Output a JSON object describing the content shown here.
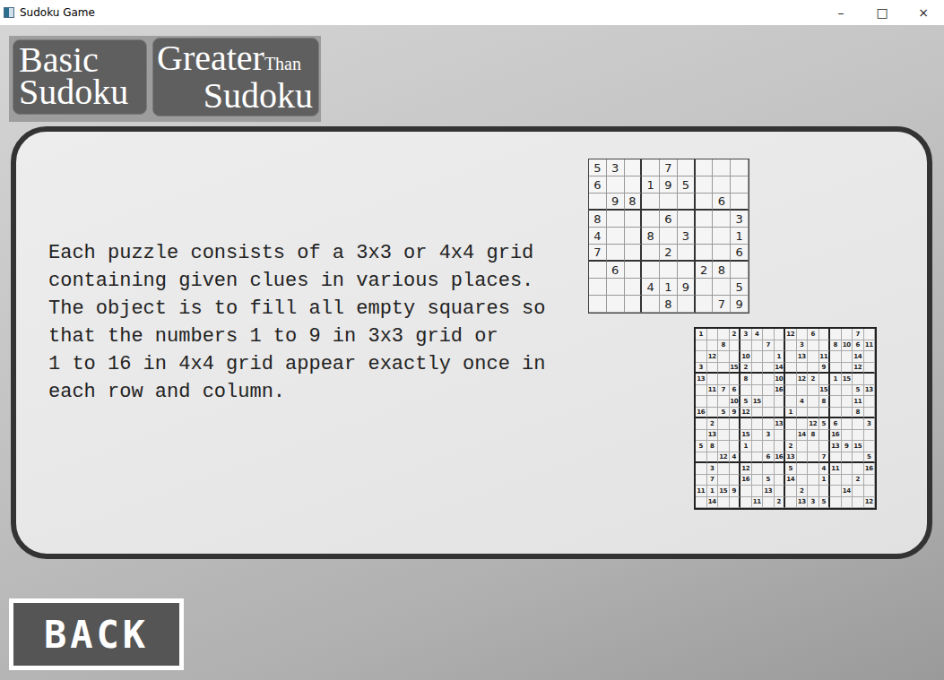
{
  "window": {
    "title": "Sudoku Game",
    "controls": [
      "–",
      "□",
      "×"
    ]
  },
  "tabs": [
    {
      "title": "Basic",
      "suffix": "",
      "subtitle": "Sudoku",
      "selected": false
    },
    {
      "title": "Greater",
      "suffix": "Than",
      "subtitle": "Sudoku",
      "selected": false
    }
  ],
  "instructions": {
    "lines": [
      "Each puzzle consists of a 3x3 or 4x4 grid",
      "containing given clues in various places.",
      "The object is to fill all empty squares so",
      "that the numbers 1 to 9 in 3x3 grid or",
      "1 to 16 in 4x4 grid appear exactly once in",
      "each row and column."
    ]
  },
  "grids": [
    {
      "rows": [
        [
          "5",
          "3",
          "",
          "",
          "7",
          "",
          "",
          "",
          ""
        ],
        [
          "6",
          "",
          "",
          "1",
          "9",
          "5",
          "",
          "",
          ""
        ],
        [
          "",
          "9",
          "8",
          "",
          "",
          "",
          "",
          "6",
          ""
        ],
        [
          "8",
          "",
          "",
          "",
          "6",
          "",
          "",
          "",
          "3"
        ],
        [
          "4",
          "",
          "",
          "8",
          "",
          "3",
          "",
          "",
          "1"
        ],
        [
          "7",
          "",
          "",
          "",
          "2",
          "",
          "",
          "",
          "6"
        ],
        [
          "",
          "6",
          "",
          "",
          "",
          "",
          "2",
          "8",
          ""
        ],
        [
          "",
          "",
          "",
          "4",
          "1",
          "9",
          "",
          "",
          "5"
        ],
        [
          "",
          "",
          "",
          "",
          "8",
          "",
          "",
          "7",
          "9"
        ]
      ]
    },
    {
      "rows": [
        [
          "1",
          "",
          "",
          "2",
          "3",
          "4",
          "",
          "",
          "12",
          "",
          "6",
          "",
          "",
          "",
          "7",
          ""
        ],
        [
          "",
          "",
          "8",
          "",
          "",
          "",
          "7",
          "",
          "",
          "3",
          "",
          "",
          "8",
          "10",
          "6",
          "11"
        ],
        [
          "",
          "12",
          "",
          "",
          "10",
          "",
          "",
          "1",
          "",
          "13",
          "",
          "11",
          "",
          "",
          "14",
          ""
        ],
        [
          "3",
          "",
          "",
          "15",
          "2",
          "",
          "",
          "14",
          "",
          "",
          "",
          "9",
          "",
          "",
          "12",
          ""
        ],
        [
          "13",
          "",
          "",
          "",
          "8",
          "",
          "",
          "10",
          "",
          "12",
          "2",
          "",
          "1",
          "15",
          "",
          ""
        ],
        [
          "",
          "11",
          "7",
          "6",
          "",
          "",
          "",
          "16",
          "",
          "",
          "",
          "15",
          "",
          "",
          "5",
          "13"
        ],
        [
          "",
          "",
          "",
          "10",
          "5",
          "15",
          "",
          "",
          "",
          "4",
          "",
          "8",
          "",
          "",
          "11",
          ""
        ],
        [
          "16",
          "",
          "5",
          "9",
          "12",
          "",
          "",
          "",
          "1",
          "",
          "",
          "",
          "",
          "",
          "8",
          ""
        ],
        [
          "",
          "2",
          "",
          "",
          "",
          "",
          "",
          "13",
          "",
          "",
          "12",
          "5",
          "6",
          "",
          "",
          "3"
        ],
        [
          "",
          "13",
          "",
          "",
          "15",
          "",
          "3",
          "",
          "",
          "14",
          "8",
          "",
          "16",
          "",
          "",
          ""
        ],
        [
          "5",
          "8",
          "",
          "",
          "1",
          "",
          "",
          "",
          "2",
          "",
          "",
          "",
          "13",
          "9",
          "15",
          ""
        ],
        [
          "",
          "",
          "12",
          "4",
          "",
          "",
          "6",
          "16",
          "13",
          "",
          "",
          "7",
          "",
          "",
          "",
          "5"
        ],
        [
          "",
          "3",
          "",
          "",
          "12",
          "",
          "",
          "",
          "5",
          "",
          "",
          "4",
          "11",
          "",
          "",
          "16"
        ],
        [
          "",
          "7",
          "",
          "",
          "16",
          "",
          "5",
          "",
          "14",
          "",
          "",
          "1",
          "",
          "",
          "2",
          ""
        ],
        [
          "11",
          "1",
          "15",
          "9",
          "",
          "",
          "13",
          "",
          "",
          "2",
          "",
          "",
          "",
          "14",
          "",
          ""
        ],
        [
          "",
          "14",
          "",
          "",
          "",
          "11",
          "",
          "2",
          "",
          "13",
          "3",
          "5",
          "",
          "",
          "",
          "12"
        ]
      ]
    }
  ],
  "back_button": {
    "label": "BACK"
  }
}
